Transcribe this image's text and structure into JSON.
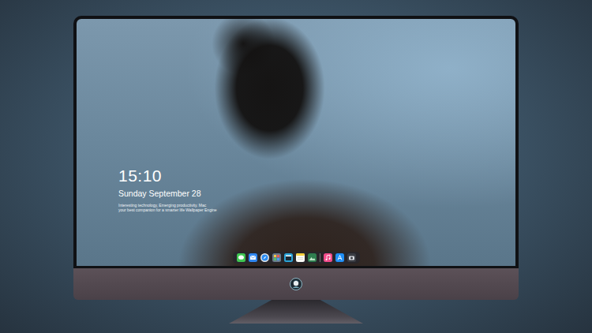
{
  "screen": {
    "time": "15:10",
    "date": "Sunday September 28",
    "caption": [
      "Interesting technology, Emerging productivity. Mac",
      "your best companion for a smarter life Wallpaper Engine"
    ]
  },
  "dock": {
    "apps": [
      {
        "kind": "messages"
      },
      {
        "kind": "mail"
      },
      {
        "kind": "safari"
      },
      {
        "kind": "launchpad"
      },
      {
        "kind": "clapper"
      },
      {
        "kind": "notes"
      },
      {
        "kind": "photos"
      },
      {
        "kind": "separator"
      },
      {
        "kind": "music"
      },
      {
        "kind": "appstore"
      },
      {
        "kind": "camera"
      }
    ]
  }
}
